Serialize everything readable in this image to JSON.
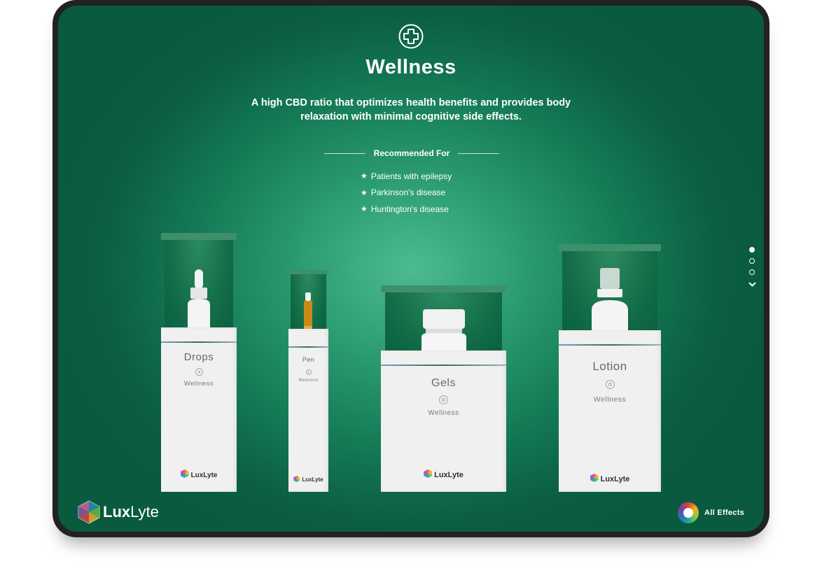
{
  "page": {
    "icon": "medical-cross-icon",
    "title": "Wellness",
    "description": "A high CBD ratio that optimizes health benefits and provides body relaxation with minimal cognitive side effects.",
    "recommended_heading": "Recommended For",
    "recommended_items": [
      "Patients with epilepsy",
      "Parkinson's disease",
      "Huntington's disease"
    ]
  },
  "products": [
    {
      "name": "Drops",
      "category": "Wellness",
      "brand": "LuxLyte",
      "contents": "dropper-bottle"
    },
    {
      "name": "Pen",
      "category": "Wellness",
      "brand": "LuxLyte",
      "contents": "vape-cartridge"
    },
    {
      "name": "Gels",
      "category": "Wellness",
      "brand": "LuxLyte",
      "contents": "pill-bottle"
    },
    {
      "name": "Lotion",
      "category": "Wellness",
      "brand": "LuxLyte",
      "contents": "pump-bottle"
    }
  ],
  "pagination": {
    "pages": 3,
    "current": 1
  },
  "footer": {
    "logo_bold": "Lux",
    "logo_light": "Lyte",
    "all_effects_label": "All Effects"
  },
  "colors": {
    "background": "#0b5e41",
    "accent": "#4cbb91",
    "text": "#ffffff"
  }
}
